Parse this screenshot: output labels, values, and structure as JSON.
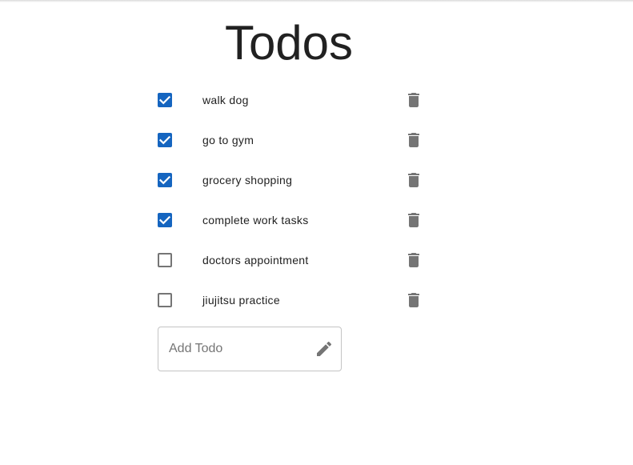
{
  "page": {
    "title": "Todos"
  },
  "todos": [
    {
      "label": "walk dog",
      "checked": true
    },
    {
      "label": "go to gym",
      "checked": true
    },
    {
      "label": "grocery shopping",
      "checked": true
    },
    {
      "label": "complete work tasks",
      "checked": true
    },
    {
      "label": "doctors appointment",
      "checked": false
    },
    {
      "label": "jiujitsu practice",
      "checked": false
    }
  ],
  "add_todo": {
    "placeholder": "Add Todo",
    "value": "",
    "icon": "pencil-icon"
  },
  "icons": {
    "delete": "trash-icon",
    "check": "checkmark-icon"
  },
  "colors": {
    "checkbox_checked": "#1565c0",
    "checkbox_unchecked_border": "#757575",
    "icon_gray": "#757575",
    "text": "#212121"
  }
}
